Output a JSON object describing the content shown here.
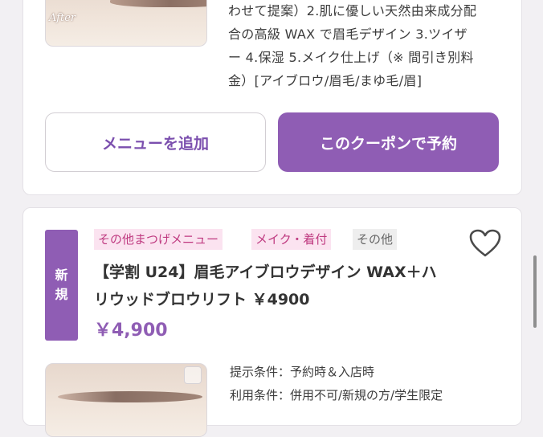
{
  "card1": {
    "photo_label": "After",
    "description_lines": [
      "わせて提案）2.肌に優しい天然由来成分配",
      "合の高級 WAX で眉毛デザイン 3.ツイザ",
      "ー 4.保湿 5.メイク仕上げ（※ 間引き別料",
      "金）[アイブロウ/眉毛/まゆ毛/眉]"
    ],
    "add_menu_label": "メニューを追加",
    "reserve_label": "このクーポンで予約"
  },
  "card2": {
    "badge_chars": [
      "新",
      "規"
    ],
    "tags": [
      "その他まつげメニュー",
      "メイク・着付",
      "その他"
    ],
    "title_lines": [
      "【学割 U24】眉毛アイブロウデザイン WAX＋ハ",
      "リウッドブロウリフト ￥4900"
    ],
    "price": "￥4,900",
    "conditions": [
      "提示条件：予約時＆入店時",
      "利用条件：併用不可/新規の方/学生限定"
    ]
  },
  "colors": {
    "accent": "#8f5db4",
    "tag_pink_bg": "#fbe3f0",
    "tag_pink_text": "#bf3a80",
    "tag_gray_bg": "#eeeeee"
  },
  "icons": {
    "favorite": "heart-outline-icon",
    "photo": "image-icon"
  }
}
